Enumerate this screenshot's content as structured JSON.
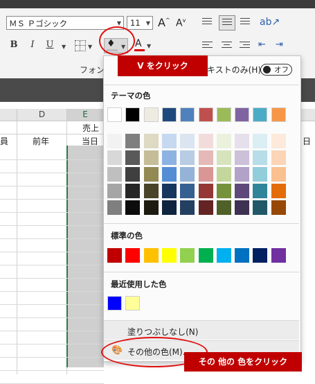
{
  "ribbon": {
    "font_name": "ＭＳ Ｐゴシック",
    "font_size": "11",
    "grow_font": "A",
    "shrink_font": "A",
    "bold": "B",
    "italic": "I",
    "underline": "U",
    "font_color_letter": "A",
    "group_label": "フォント",
    "text_only_label": "テキストのみ(H)",
    "toggle_label": "オフ"
  },
  "sheet": {
    "columns": [
      "D",
      "E"
    ],
    "merged_header": "売上",
    "row_labels": [
      "前年",
      "当日"
    ],
    "left_edge_char": "員",
    "right_edge_char": "日"
  },
  "palette": {
    "theme_header": "テーマの色",
    "standard_header": "標準の色",
    "recent_header": "最近使用した色",
    "no_fill": "塗りつぶしなし(N)",
    "more_colors": "その他の色(M)...",
    "theme_top": [
      "#FFFFFF",
      "#000000",
      "#EEECE1",
      "#1F497D",
      "#4F81BD",
      "#C0504D",
      "#9BBB59",
      "#8064A2",
      "#4BACC6",
      "#F79646"
    ],
    "theme_shades": [
      [
        "#F2F2F2",
        "#7F7F7F",
        "#DDD9C3",
        "#C6D9F0",
        "#DBE5F1",
        "#F2DCDB",
        "#EBF1DD",
        "#E5E0EC",
        "#DBEEF3",
        "#FDEADA"
      ],
      [
        "#D8D8D8",
        "#595959",
        "#C4BD97",
        "#8DB3E2",
        "#B8CCE4",
        "#E5B9B7",
        "#D7E3BC",
        "#CCC1D9",
        "#B7DDE8",
        "#FBD5B5"
      ],
      [
        "#BFBFBF",
        "#3F3F3F",
        "#938953",
        "#548DD4",
        "#95B3D7",
        "#D99694",
        "#C3D69B",
        "#B2A2C7",
        "#92CDDC",
        "#FAC08F"
      ],
      [
        "#A5A5A5",
        "#262626",
        "#494429",
        "#17365D",
        "#366092",
        "#953734",
        "#76923C",
        "#5F497A",
        "#31859B",
        "#E36C09"
      ],
      [
        "#7F7F7F",
        "#0C0C0C",
        "#1D1B10",
        "#0F243E",
        "#244061",
        "#632423",
        "#4F6128",
        "#3F3151",
        "#205867",
        "#974806"
      ]
    ],
    "standard": [
      "#C00000",
      "#FF0000",
      "#FFC000",
      "#FFFF00",
      "#92D050",
      "#00B050",
      "#00B0F0",
      "#0070C0",
      "#002060",
      "#7030A0"
    ],
    "recent": [
      "#0000FF",
      "#FFFF99"
    ]
  },
  "annotations": {
    "callout1": "V をクリック",
    "callout2": "その 他の 色をクリック",
    "accent": "#C00000"
  }
}
